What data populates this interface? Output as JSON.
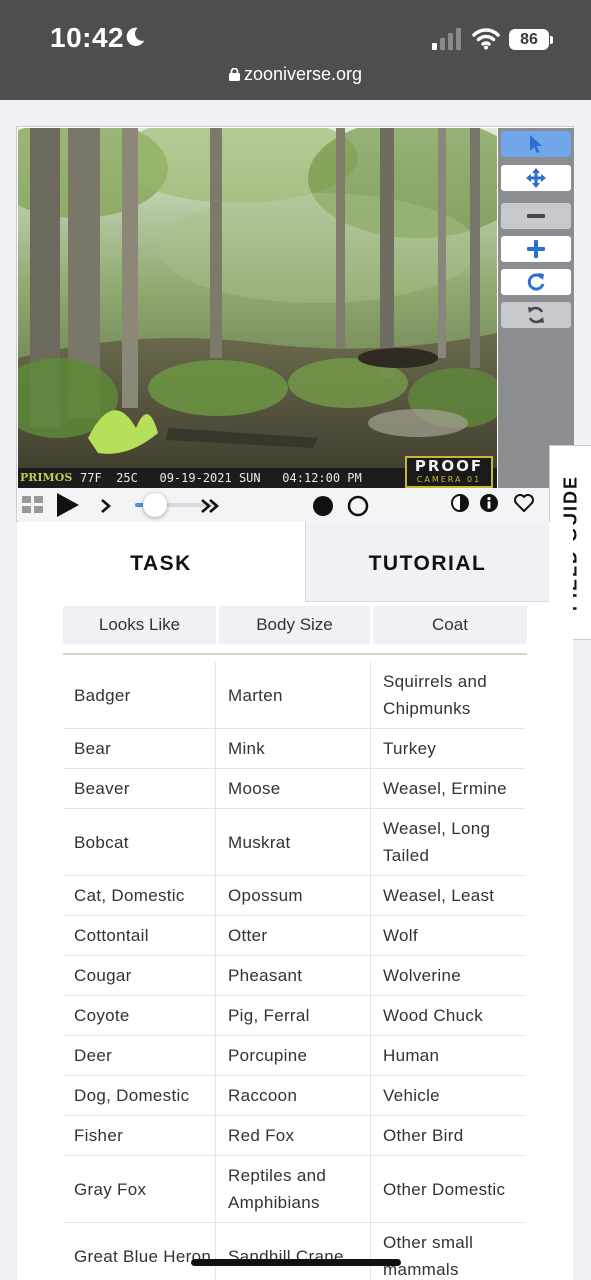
{
  "status_bar": {
    "time": "10:42",
    "battery": "86"
  },
  "browser": {
    "url": "zooniverse.org"
  },
  "camera_overlay": {
    "brand": "PRIMOS",
    "info": "77F  25C   09-19-2021 SUN   04:12:00 PM",
    "logo_main": "PROOF",
    "logo_sub": "CAMERA 01"
  },
  "toolbar": {
    "tools": [
      {
        "name": "select-tool",
        "icon": "cursor-arrow-icon"
      },
      {
        "name": "pan-tool",
        "icon": "move-arrows-icon"
      },
      {
        "name": "zoom-out-tool",
        "icon": "minus-icon"
      },
      {
        "name": "zoom-in-tool",
        "icon": "plus-icon"
      },
      {
        "name": "rotate-tool",
        "icon": "rotate-icon"
      },
      {
        "name": "reset-tool",
        "icon": "refresh-icon"
      }
    ]
  },
  "playback": {
    "slider_position": 0.12
  },
  "field_guide": {
    "label": "FIELD GUIDE"
  },
  "tabs": {
    "task": "TASK",
    "tutorial": "TUTORIAL"
  },
  "filters": [
    "Looks Like",
    "Body Size",
    "Coat"
  ],
  "species_rows": [
    [
      "Badger",
      "Marten",
      "Squirrels and Chipmunks"
    ],
    [
      "Bear",
      "Mink",
      "Turkey"
    ],
    [
      "Beaver",
      "Moose",
      "Weasel, Ermine"
    ],
    [
      "Bobcat",
      "Muskrat",
      "Weasel, Long Tailed"
    ],
    [
      "Cat, Domestic",
      "Opossum",
      "Weasel, Least"
    ],
    [
      "Cottontail",
      "Otter",
      "Wolf"
    ],
    [
      "Cougar",
      "Pheasant",
      "Wolverine"
    ],
    [
      "Coyote",
      "Pig, Ferral",
      "Wood Chuck"
    ],
    [
      "Deer",
      "Porcupine",
      "Human"
    ],
    [
      "Dog, Domestic",
      "Raccoon",
      "Vehicle"
    ],
    [
      "Fisher",
      "Red Fox",
      "Other Bird"
    ],
    [
      "Gray Fox",
      "Reptiles and Amphibians",
      "Other Domestic"
    ],
    [
      "Great Blue Heron",
      "Sandhill Crane",
      "Other small mammals"
    ]
  ],
  "colors": {
    "accent": "#4a90e2",
    "active_tool": "#6fa7e8",
    "status_bar": "#4e4e4e"
  }
}
